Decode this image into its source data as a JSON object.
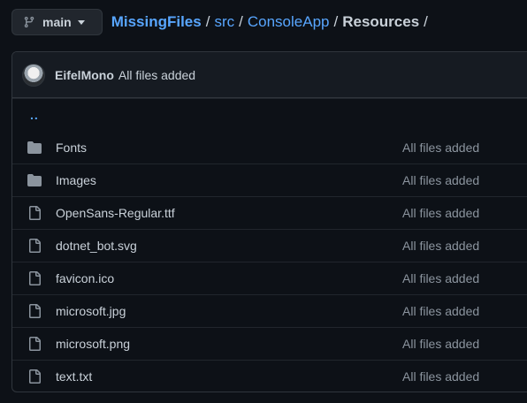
{
  "branch": {
    "label": "main"
  },
  "breadcrumb": {
    "repo": "MissingFiles",
    "parts": [
      "src",
      "ConsoleApp"
    ],
    "current": "Resources",
    "separator": "/"
  },
  "commit": {
    "author": "EifelMono",
    "message": "All files added"
  },
  "parent_link": "..",
  "files": [
    {
      "name": "Fonts",
      "type": "folder",
      "commit": "All files added"
    },
    {
      "name": "Images",
      "type": "folder",
      "commit": "All files added"
    },
    {
      "name": "OpenSans-Regular.ttf",
      "type": "file",
      "commit": "All files added"
    },
    {
      "name": "dotnet_bot.svg",
      "type": "file",
      "commit": "All files added"
    },
    {
      "name": "favicon.ico",
      "type": "file",
      "commit": "All files added"
    },
    {
      "name": "microsoft.jpg",
      "type": "file",
      "commit": "All files added"
    },
    {
      "name": "microsoft.png",
      "type": "file",
      "commit": "All files added"
    },
    {
      "name": "text.txt",
      "type": "file",
      "commit": "All files added"
    }
  ],
  "colors": {
    "link": "#58a6ff",
    "background": "#0d1117",
    "muted": "#8b949e"
  },
  "icons": {
    "branch": "git-branch-icon",
    "folder": "folder-icon",
    "file": "file-icon",
    "caret": "caret-down-icon"
  }
}
